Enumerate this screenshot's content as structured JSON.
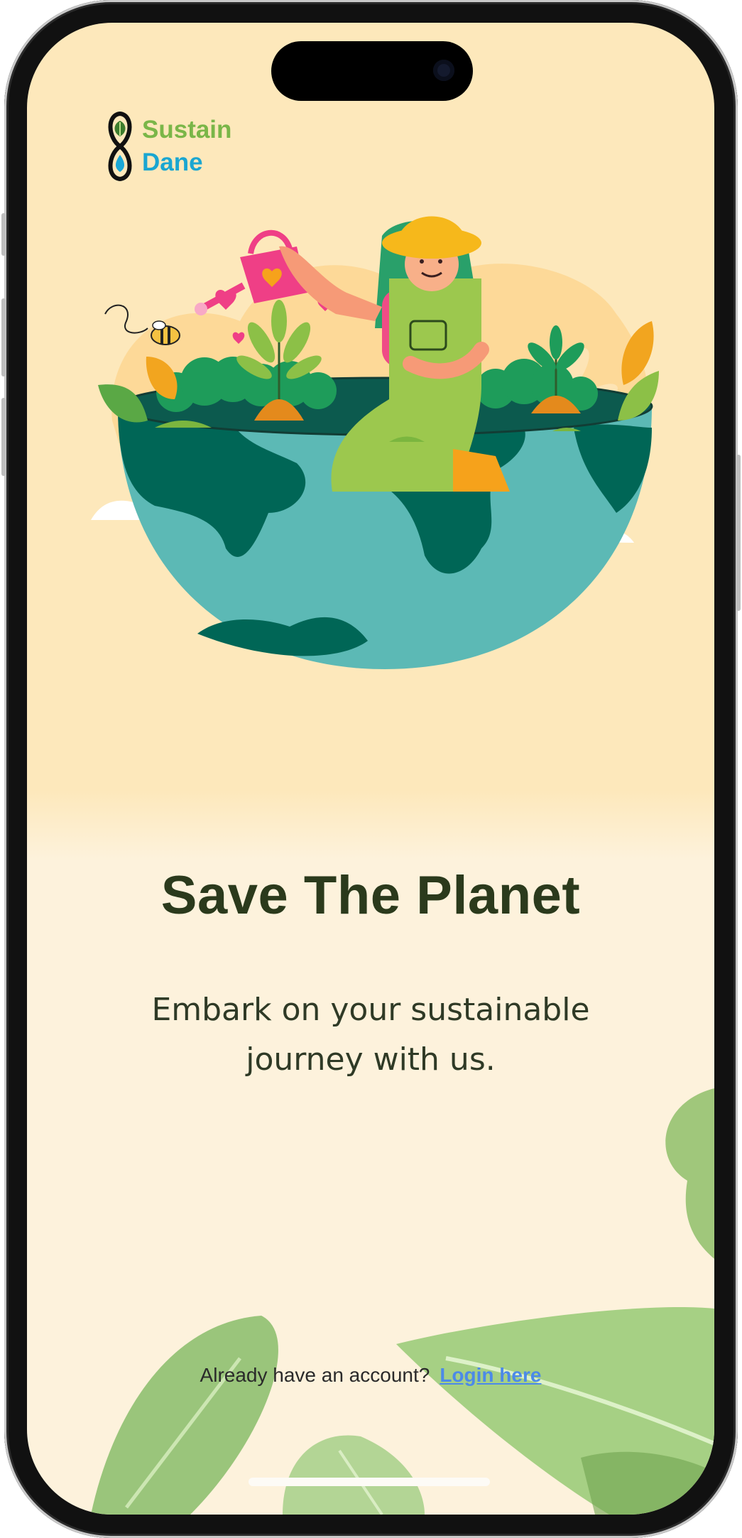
{
  "app": {
    "logo_line1": "Sustain",
    "logo_line2": "Dane"
  },
  "welcome": {
    "title": "Save The Planet",
    "subtitle": "Embark on your sustainable journey with us."
  },
  "login": {
    "prompt": "Already have an account?",
    "link_label": "Login here"
  },
  "colors": {
    "background_top": "#fde8bb",
    "background_bottom": "#fdf2dc",
    "logo_green": "#7ab648",
    "logo_blue": "#1aa6d1",
    "title": "#2b3a1c",
    "link": "#4c8ae8"
  },
  "icons": {
    "logo": "infinity-leaf-drop-icon"
  }
}
